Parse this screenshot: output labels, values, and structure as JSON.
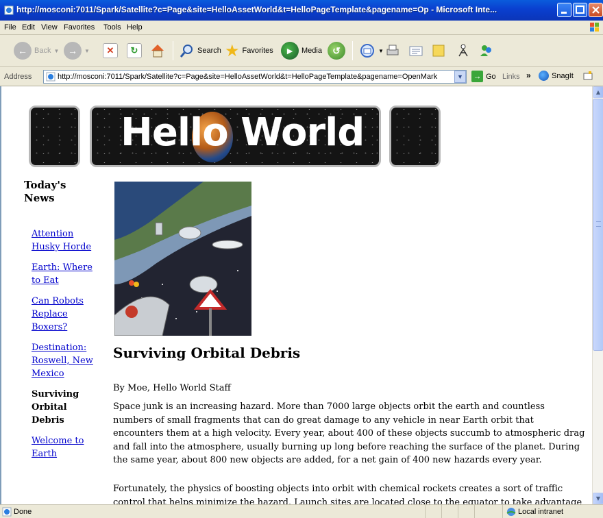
{
  "window": {
    "title": "http://mosconi:7011/Spark/Satellite?c=Page&site=HelloAssetWorld&t=HelloPageTemplate&pagename=Op - Microsoft Inte..."
  },
  "menu": [
    "File",
    "Edit",
    "View",
    "Favorites",
    "Tools",
    "Help"
  ],
  "toolbar": {
    "back": "Back",
    "search": "Search",
    "favorites": "Favorites",
    "media": "Media"
  },
  "address": {
    "label": "Address",
    "url": "http://mosconi:7011/Spark/Satellite?c=Page&site=HelloAssetWorld&t=HelloPageTemplate&pagename=OpenMark",
    "go": "Go",
    "links": "Links",
    "snagit": "SnagIt"
  },
  "page": {
    "banner_title": "Hello World",
    "sidebar_heading": "Today's News",
    "nav": [
      {
        "label": "Attention Husky Horde",
        "current": false
      },
      {
        "label": "Earth: Where to Eat",
        "current": false
      },
      {
        "label": "Can Robots Replace Boxers?",
        "current": false
      },
      {
        "label": "Destination: Roswell, New Mexico",
        "current": false
      },
      {
        "label": "Surviving Orbital Debris",
        "current": true
      },
      {
        "label": "Welcome to Earth",
        "current": false
      }
    ],
    "article": {
      "title": "Surviving Orbital Debris",
      "byline": "By Moe, Hello World Staff",
      "paragraphs": [
        "Space junk is an increasing hazard. More than 7000 large objects orbit the earth and countless numbers of small fragments that can do great damage to any vehicle in near Earth orbit that encounters them at a high velocity. Every year, about 400 of these objects succumb to atmospheric drag and fall into the atmosphere, usually burning up long before reaching the surface of the planet. During the same year, about 800 new objects are added, for a net gain of 400 new hazards every year.",
        "Fortunately, the physics of boosting objects into orbit with chemical rockets creates a sort of traffic control that helps minimize the hazard. Launch sites are located close to the equator to take advantage of the rotation"
      ]
    }
  },
  "status": {
    "text": "Done",
    "zone": "Local intranet"
  }
}
